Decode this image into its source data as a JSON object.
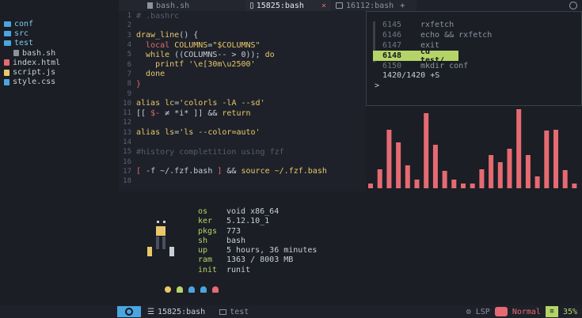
{
  "tabs": [
    {
      "label": "bash.sh",
      "active": false
    },
    {
      "label": "15825:bash",
      "active": true,
      "close": "×"
    },
    {
      "label": "16112:bash",
      "active": false
    },
    {
      "label": "+"
    }
  ],
  "sidebar": {
    "items": [
      {
        "label": "conf",
        "kind": "folder",
        "indent": 0
      },
      {
        "label": "src",
        "kind": "folder",
        "indent": 0
      },
      {
        "label": "test",
        "kind": "folder",
        "indent": 0
      },
      {
        "label": "bash.sh",
        "kind": "file",
        "indent": 1,
        "color": "#8c93a0"
      },
      {
        "label": "index.html",
        "kind": "file",
        "indent": 0,
        "color": "#e66a72"
      },
      {
        "label": "script.js",
        "kind": "file",
        "indent": 0,
        "color": "#e8c86a"
      },
      {
        "label": "style.css",
        "kind": "file",
        "indent": 0,
        "color": "#4aa5e0"
      }
    ]
  },
  "editor": {
    "lines": [
      {
        "n": "1",
        "parts": [
          [
            "cm",
            "# .bashrc"
          ]
        ]
      },
      {
        "n": "2",
        "parts": []
      },
      {
        "n": "3",
        "parts": [
          [
            "kw",
            "draw_line"
          ],
          [
            "pl",
            "() {"
          ]
        ]
      },
      {
        "n": "4",
        "parts": [
          [
            "pl",
            "  "
          ],
          [
            "fn",
            "local"
          ],
          [
            "pl",
            " "
          ],
          [
            "kw",
            "COLUMNS"
          ],
          [
            "pl",
            "="
          ],
          [
            "str",
            "\"$COLUMNS\""
          ]
        ]
      },
      {
        "n": "5",
        "parts": [
          [
            "pl",
            "  "
          ],
          [
            "kw",
            "while"
          ],
          [
            "pl",
            " ((COLUMNS-- > 0)); "
          ],
          [
            "kw",
            "do"
          ]
        ]
      },
      {
        "n": "6",
        "parts": [
          [
            "pl",
            "    "
          ],
          [
            "kw",
            "printf"
          ],
          [
            "pl",
            " "
          ],
          [
            "str",
            "'\\e[30m\\u2500'"
          ]
        ]
      },
      {
        "n": "7",
        "parts": [
          [
            "pl",
            "  "
          ],
          [
            "kw",
            "done"
          ]
        ]
      },
      {
        "n": "8",
        "parts": [
          [
            "fn",
            "}"
          ]
        ]
      },
      {
        "n": "9",
        "parts": []
      },
      {
        "n": "10",
        "parts": [
          [
            "kw",
            "alias"
          ],
          [
            "pl",
            " "
          ],
          [
            "kw",
            "lc"
          ],
          [
            "pl",
            "="
          ],
          [
            "str",
            "'colorls -lA --sd'"
          ]
        ]
      },
      {
        "n": "11",
        "parts": [
          [
            "pl",
            "[[ "
          ],
          [
            "fn",
            "$-"
          ],
          [
            "pl",
            " ≠ "
          ],
          [
            "pl",
            "*i*"
          ],
          [
            "pl",
            " ]] && "
          ],
          [
            "kw",
            "return"
          ]
        ]
      },
      {
        "n": "12",
        "parts": []
      },
      {
        "n": "13",
        "parts": [
          [
            "kw",
            "alias"
          ],
          [
            "pl",
            " "
          ],
          [
            "kw",
            "ls"
          ],
          [
            "pl",
            "="
          ],
          [
            "str",
            "'ls --color=auto'"
          ]
        ]
      },
      {
        "n": "14",
        "parts": []
      },
      {
        "n": "15",
        "parts": [
          [
            "cm",
            "#history completition using fzf"
          ]
        ]
      },
      {
        "n": "16",
        "parts": []
      },
      {
        "n": "17",
        "parts": [
          [
            "fn",
            "["
          ],
          [
            "pl",
            " -f ~/.fzf.bash "
          ],
          [
            "fn",
            "]"
          ],
          [
            "pl",
            " && "
          ],
          [
            "kw",
            "source"
          ],
          [
            "pl",
            " "
          ],
          [
            "str",
            "~/.fzf.bash"
          ]
        ]
      },
      {
        "n": "18",
        "parts": []
      }
    ]
  },
  "history": {
    "rows": [
      {
        "num": "6145",
        "cmd": "rxfetch",
        "selected": false
      },
      {
        "num": "6146",
        "cmd": "echo && rxfetch",
        "selected": false
      },
      {
        "num": "6147",
        "cmd": "exit",
        "selected": false
      },
      {
        "num": "6148",
        "cmd": "cd test/",
        "selected": true
      },
      {
        "num": "6150",
        "cmd": "mkdir conf",
        "selected": false
      }
    ],
    "count": "1420/1420 +S",
    "prompt": ">"
  },
  "visualizer": {
    "color": "#e66a72",
    "levels": [
      0.06,
      0.24,
      0.74,
      0.58,
      0.29,
      0.11,
      0.95,
      0.55,
      0.22,
      0.11,
      0.06,
      0.06,
      0.24,
      0.42,
      0.33,
      0.5,
      1.0,
      0.42,
      0.15,
      0.73,
      0.74,
      0.23,
      0.06
    ]
  },
  "fetch": {
    "rows": [
      {
        "key": "os",
        "value": "void x86_64"
      },
      {
        "key": "ker",
        "value": "5.12.10_1"
      },
      {
        "key": "pkgs",
        "value": "773"
      },
      {
        "key": "sh",
        "value": "bash"
      },
      {
        "key": "up",
        "value": "5 hours, 36 minutes"
      },
      {
        "key": "ram",
        "value": "1363 / 8003 MB"
      },
      {
        "key": "init",
        "value": "runit"
      }
    ],
    "ghost_colors": [
      "#e8c86a",
      "#b5d468",
      "#4aa5e0",
      "#4aa5e0",
      "#e66a72"
    ]
  },
  "status": {
    "terminal": "15825:bash",
    "dir": "test",
    "lsp": "LSP",
    "mode": "Normal",
    "percent": "35%"
  }
}
